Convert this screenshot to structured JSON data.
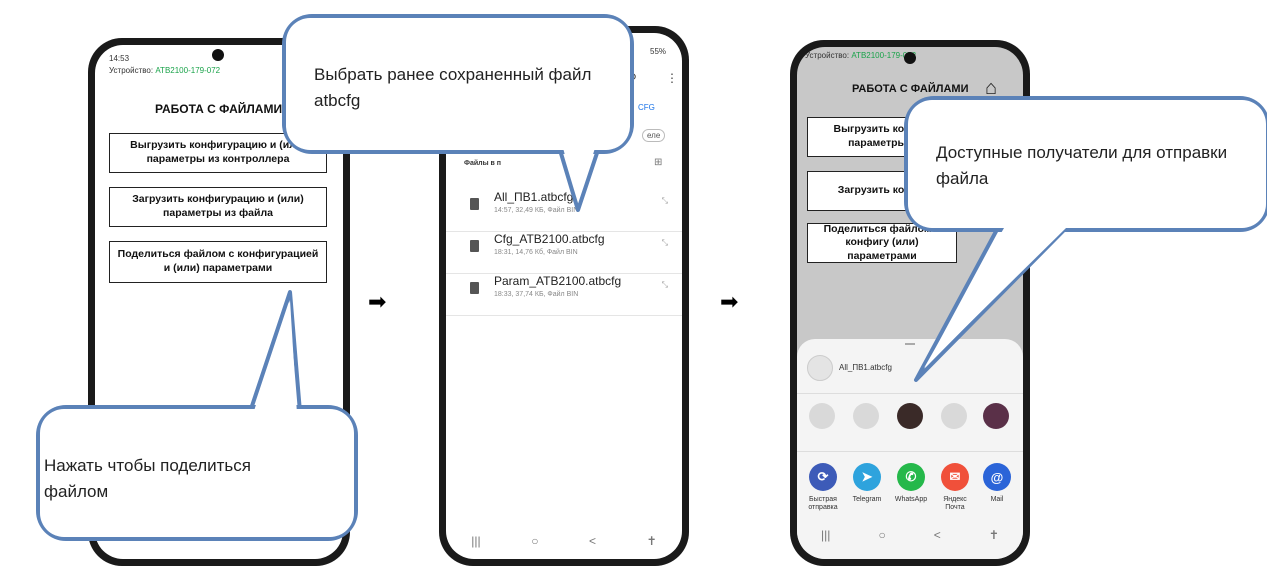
{
  "phone1": {
    "status_time": "14:53",
    "status_right": "ⓢ ⓢ",
    "device_label": "Устройство:",
    "device_id": "ATB2100-179-072",
    "title": "РАБОТА С ФАЙЛАМИ",
    "buttons": [
      "Выгрузить конфигурацию и (или) параметры из контроллера",
      "Загрузить конфигурацию и (или) параметры из файла",
      "Поделиться файлом с конфигурацией и (или) параметрами"
    ],
    "nav": [
      "|||",
      "○",
      "<"
    ]
  },
  "phone2": {
    "status_right": "55%",
    "search_icon": "search-icon",
    "filter_chip": "CFG",
    "sort_chip": "еле",
    "section_label": "Файлы в п",
    "files": [
      {
        "name": "All_ПВ1.atbcfg",
        "meta": "14:57, 32,49 КБ, Файл BIN"
      },
      {
        "name": "Cfg_ATB2100.atbcfg",
        "meta": "18:31, 14,76 Кб, Файл BIN"
      },
      {
        "name": "Param_ATB2100.atbcfg",
        "meta": "18:33, 37,74 КБ, Файл BIN"
      }
    ],
    "nav": [
      "|||",
      "○",
      "<"
    ]
  },
  "phone3": {
    "device_label": "Устройство:",
    "device_id": "ATB2100-179-072",
    "title": "РАБОТА С ФАЙЛАМИ",
    "buttons": [
      "Выгрузить конфиг параметры и",
      "Загрузить конфи",
      "Поделиться файлом с конфигу (или) параметрами"
    ],
    "share_file": "All_ПВ1.atbcfg",
    "apps": [
      {
        "label": "Быстрая отправка",
        "color": "#3d5bb8",
        "icon": "quick-share-icon"
      },
      {
        "label": "Telegram",
        "color": "#2ea3dd",
        "icon": "telegram-icon"
      },
      {
        "label": "WhatsApp",
        "color": "#25b84a",
        "icon": "whatsapp-icon"
      },
      {
        "label": "Яндекс Почта",
        "color": "#f0503a",
        "icon": "yandex-mail-icon"
      },
      {
        "label": "Mail",
        "color": "#2b64d8",
        "icon": "mail-icon"
      }
    ],
    "nav": [
      "|||",
      "○",
      "<"
    ]
  },
  "callouts": {
    "c1": "Нажать чтобы поделиться файлом",
    "c2": "Выбрать ранее сохраненный файл atbcfg",
    "c3": "Доступные получатели для отправки файла"
  },
  "arrows": [
    "➡",
    "➡"
  ],
  "colors": {
    "callout_border": "#5b82b8",
    "device_green": "#1aa34a"
  }
}
